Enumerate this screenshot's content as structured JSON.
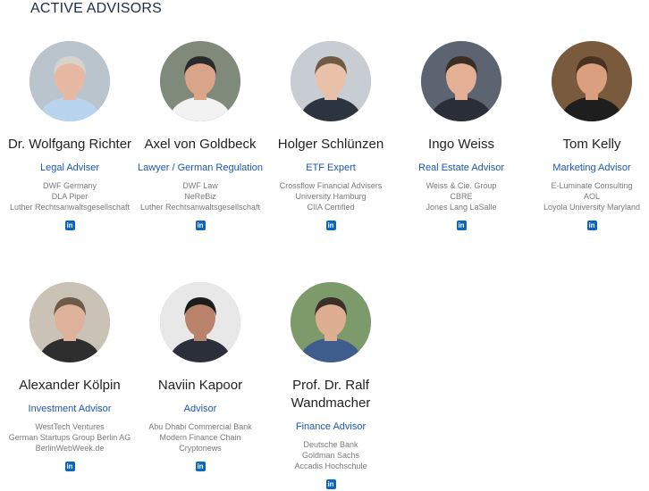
{
  "section": {
    "title": "ACTIVE ADVISORS"
  },
  "advisors": [
    {
      "name": "Dr. Wolfgang Richter",
      "role": "Legal Adviser",
      "affiliations": [
        "DWF Germany",
        "DLA Piper",
        "Luther Rechtsanwaltsgesellschaft"
      ],
      "linkedin_icon": "in",
      "colors": {
        "bg": "#b9c4cc",
        "skin": "#e8b9a2",
        "hair": "#d7d3cc",
        "shirt": "#b8d4ef"
      }
    },
    {
      "name": "Axel von Goldbeck",
      "role": "Lawyer / German Regulation",
      "affiliations": [
        "DWF Law",
        "NeReBiz",
        "Luther Rechtsanwaltsgesellschaft"
      ],
      "linkedin_icon": "in",
      "colors": {
        "bg": "#7f8a7a",
        "skin": "#d9a48a",
        "hair": "#2a2a2a",
        "shirt": "#f2f2f2"
      }
    },
    {
      "name": "Holger Schlünzen",
      "role": "ETF Expert",
      "affiliations": [
        "Crossflow Financial Advisers",
        "University Hamburg",
        "CIIA Certified"
      ],
      "linkedin_icon": "in",
      "colors": {
        "bg": "#c7cdd3",
        "skin": "#e9c0a8",
        "hair": "#6e5a45",
        "shirt": "#2c3440"
      }
    },
    {
      "name": "Ingo Weiss",
      "role": "Real Estate Advisor",
      "affiliations": [
        "Weiss & Cie. Group",
        "CBRE",
        "Jones Lang LaSalle"
      ],
      "linkedin_icon": "in",
      "colors": {
        "bg": "#5b6470",
        "skin": "#e3b096",
        "hair": "#3c2e24",
        "shirt": "#2a2e38"
      }
    },
    {
      "name": "Tom Kelly",
      "role": "Marketing Advisor",
      "affiliations": [
        "E-Luminate Consulting",
        "AOL",
        "Loyola University Maryland"
      ],
      "linkedin_icon": "in",
      "colors": {
        "bg": "#7a5a3c",
        "skin": "#d99f7e",
        "hair": "#4a3220",
        "shirt": "#1e1e1e"
      }
    },
    {
      "name": "Alexander Kölpin",
      "role": "Investment Advisor",
      "affiliations": [
        "WestTech Ventures",
        "German Startups Group Berlin AG",
        "BerlinWebWeek.de"
      ],
      "linkedin_icon": "in",
      "colors": {
        "bg": "#c9c2b5",
        "skin": "#deb29a",
        "hair": "#6d5a48",
        "shirt": "#2e2e2e"
      }
    },
    {
      "name": "Naviin Kapoor",
      "role": "Advisor",
      "affiliations": [
        "Abu Dhabi Commercial Bank",
        "Modern Finance Chain",
        "Cryptonews"
      ],
      "linkedin_icon": "in",
      "colors": {
        "bg": "#e8e8e8",
        "skin": "#b9826a",
        "hair": "#1c1c1c",
        "shirt": "#2b2f3a"
      }
    },
    {
      "name": "Prof. Dr. Ralf Wandmacher",
      "role": "Finance Advisor",
      "affiliations": [
        "Deutsche Bank",
        "Goldman Sachs",
        "Accadis Hochschule"
      ],
      "linkedin_icon": "in",
      "colors": {
        "bg": "#7d9b6a",
        "skin": "#deae92",
        "hair": "#3a3028",
        "shirt": "#3e5d8c"
      }
    }
  ]
}
